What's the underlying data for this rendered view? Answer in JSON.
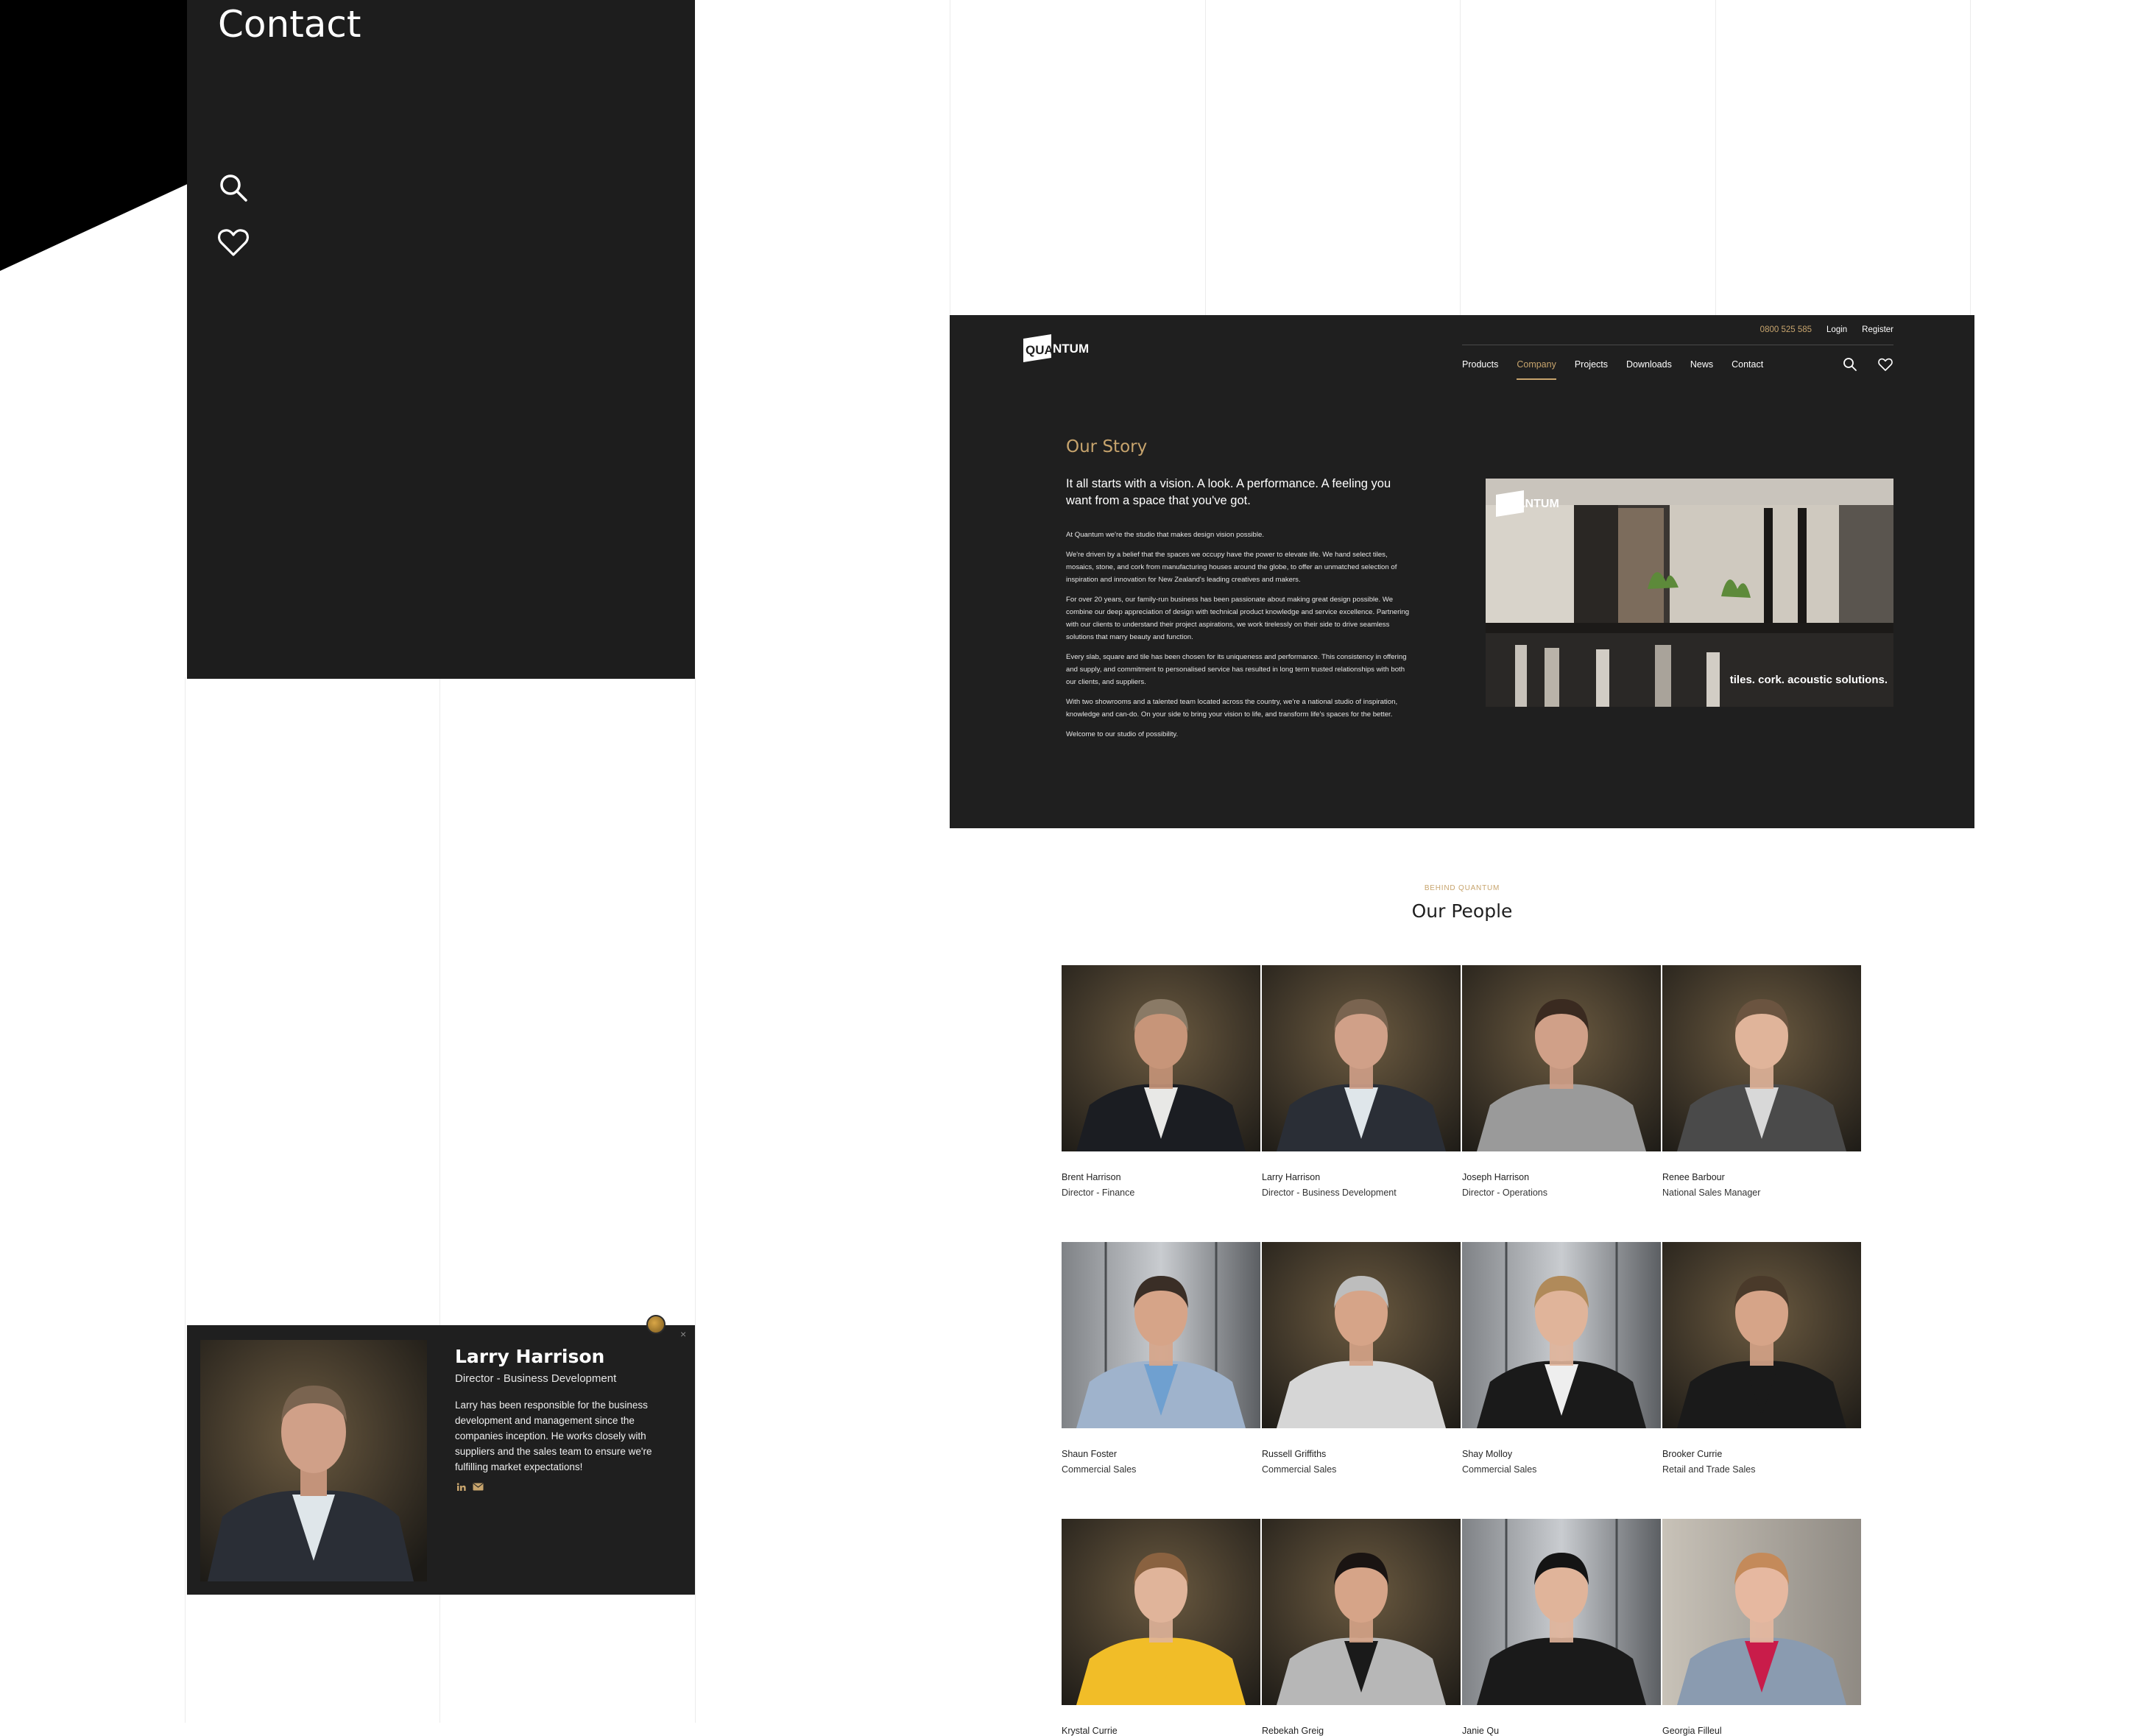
{
  "mobile_menu": {
    "contact_label": "Contact"
  },
  "modal": {
    "name": "Larry Harrison",
    "role": "Director - Business Development",
    "bio": "Larry has been responsible for the business development and management since the companies inception. He works closely with suppliers and the sales team to ensure we're fulfilling market expectations!",
    "close_label": "×"
  },
  "header": {
    "logo_text": "QUANTUM",
    "phone": "0800 525 585",
    "login": "Login",
    "register": "Register",
    "nav": [
      "Products",
      "Company",
      "Projects",
      "Downloads",
      "News",
      "Contact"
    ],
    "active_nav": "Company"
  },
  "story": {
    "title": "Our Story",
    "lead": "It all starts with a vision. A look. A performance. A feeling you want from a space that you've got.",
    "paragraphs": [
      "At Quantum we're the studio that makes design vision possible.",
      "We're driven by a belief that the spaces we occupy have the power to elevate life. We hand select tiles, mosaics, stone, and cork from manufacturing houses around the globe, to offer an unmatched selection of inspiration and innovation for New Zealand's leading creatives and makers.",
      "For over 20 years, our family-run business has been passionate about making great design possible. We combine our deep appreciation of design with technical product knowledge and service excellence. Partnering with our clients to understand their project aspirations, we work tirelessly on their side to drive seamless solutions that marry beauty and function.",
      "Every slab, square and tile has been chosen for its uniqueness and performance. This consistency in offering and supply, and commitment to personalised service has resulted in long term trusted relationships with both our clients, and suppliers.",
      "With two showrooms and a talented team located across the country, we're a national studio of inspiration, knowledge and can-do. On your side to bring your vision to life, and transform life's spaces for the better.",
      "Welcome to our studio of possibility."
    ],
    "image_caption": "tiles. cork. acoustic solutions.",
    "image_logo": "QUANTUM"
  },
  "people": {
    "kicker": "BEHIND QUANTUM",
    "title": "Our People",
    "members": [
      {
        "name": "Brent Harrison",
        "role": "Director - Finance",
        "bg": "dark",
        "hair": "#8a7a66",
        "shirt": "#e8e8e6",
        "jacket": "#1b1d22",
        "skin": "#c79579"
      },
      {
        "name": "Larry Harrison",
        "role": "Director - Business Development",
        "bg": "dark",
        "hair": "#7a6450",
        "shirt": "#dfe6ea",
        "jacket": "#2a2e36",
        "skin": "#d0a088"
      },
      {
        "name": "Joseph Harrison",
        "role": "Director - Operations",
        "bg": "dark",
        "hair": "#3a2a20",
        "shirt": "#9a9a9a",
        "jacket": "#9a9a9a",
        "skin": "#d0a088"
      },
      {
        "name": "Renee Barbour",
        "role": "National Sales Manager",
        "bg": "dark",
        "hair": "#6b5440",
        "shirt": "#d8d8d8",
        "jacket": "#4a4a4a",
        "skin": "#e0b49a"
      },
      {
        "name": "Shaun Foster",
        "role": "Commercial Sales",
        "bg": "tiles",
        "hair": "#3a2e26",
        "shirt": "#6fa0d0",
        "jacket": "#9fb3cc",
        "skin": "#d6a488"
      },
      {
        "name": "Russell Griffiths",
        "role": "Commercial Sales",
        "bg": "dark",
        "hair": "#bdbdbd",
        "shirt": "#d6d6d6",
        "jacket": "#d6d6d6",
        "skin": "#d6a488"
      },
      {
        "name": "Shay Molloy",
        "role": "Commercial Sales",
        "bg": "tiles",
        "hair": "#b08a5a",
        "shirt": "#eeeeee",
        "jacket": "#1a1a1a",
        "skin": "#e0b49a"
      },
      {
        "name": "Brooker Currie",
        "role": "Retail and Trade Sales",
        "bg": "dark",
        "hair": "#4a3a2a",
        "shirt": "#1a1a1a",
        "jacket": "#1a1a1a",
        "skin": "#d6a488"
      },
      {
        "name": "Krystal Currie",
        "role": "",
        "bg": "dark",
        "hair": "#8a6240",
        "shirt": "#f1bd28",
        "jacket": "#f1bd28",
        "skin": "#e0b49a"
      },
      {
        "name": "Rebekah Greig",
        "role": "",
        "bg": "dark",
        "hair": "#1a1412",
        "shirt": "#1a1a1a",
        "jacket": "#b7b7b7",
        "skin": "#d6a488"
      },
      {
        "name": "Janie Qu",
        "role": "",
        "bg": "tiles",
        "hair": "#141414",
        "shirt": "#1a1a1a",
        "jacket": "#1a1a1a",
        "skin": "#e0b49a"
      },
      {
        "name": "Georgia Filleul",
        "role": "",
        "bg": "light",
        "hair": "#c48a5a",
        "shirt": "#c91c4a",
        "jacket": "#8a9bb0",
        "skin": "#e6b8a0"
      }
    ]
  },
  "colors": {
    "accent": "#c7a46d",
    "dark": "#1f1f1f"
  }
}
